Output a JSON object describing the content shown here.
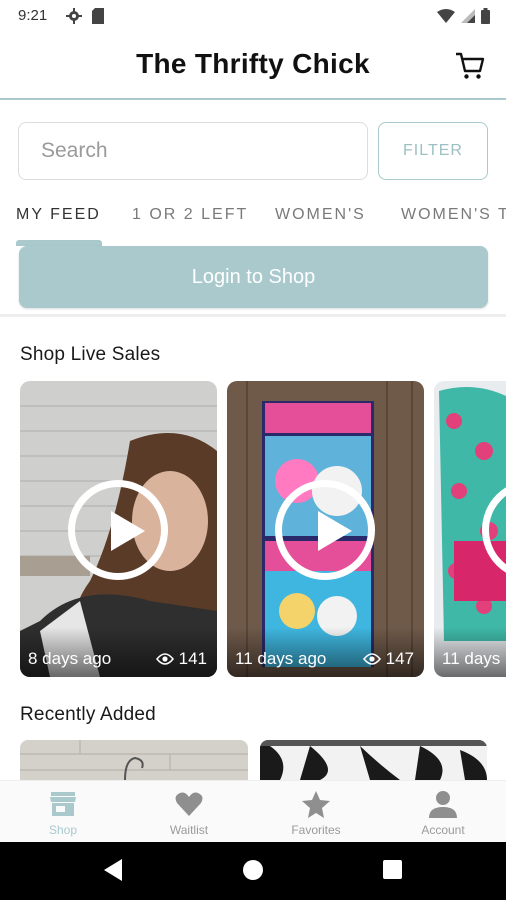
{
  "status_bar": {
    "time": "9:21"
  },
  "header": {
    "title": "The Thrifty Chick",
    "cart_icon": "shopping-cart-icon"
  },
  "search": {
    "placeholder": "Search",
    "value": "",
    "filter_label": "FILTER"
  },
  "tabs": [
    {
      "label": "MY FEED",
      "active": true
    },
    {
      "label": "1 OR 2 LEFT",
      "active": false
    },
    {
      "label": "WOMEN'S",
      "active": false
    },
    {
      "label": "WOMEN'S T",
      "active": false
    }
  ],
  "login_banner": {
    "label": "Login to Shop"
  },
  "live_sales": {
    "heading": "Shop Live Sales",
    "cards": [
      {
        "ago": "8 days ago",
        "views": "141"
      },
      {
        "ago": "11 days ago",
        "views": "147"
      },
      {
        "ago": "11 days"
      }
    ]
  },
  "recently_added": {
    "heading": "Recently Added"
  },
  "bottom_nav": [
    {
      "label": "Shop",
      "icon": "storefront-icon",
      "active": true
    },
    {
      "label": "Waitlist",
      "icon": "heart-icon",
      "active": false
    },
    {
      "label": "Favorites",
      "icon": "star-icon",
      "active": false
    },
    {
      "label": "Account",
      "icon": "person-icon",
      "active": false
    }
  ],
  "colors": {
    "accent": "#a9c9cc",
    "text": "#1a1a1a",
    "muted": "#9a9a9a"
  }
}
